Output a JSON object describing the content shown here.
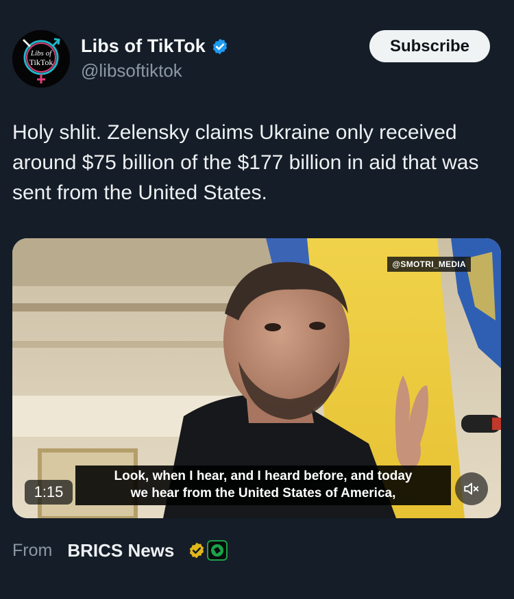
{
  "author": {
    "display_name": "Libs of TikTok",
    "handle": "@libsoftiktok",
    "avatar_text_line1": "Libs of",
    "avatar_text_line2": "TikTok",
    "verified_icon": "verified-badge-icon"
  },
  "actions": {
    "subscribe_label": "Subscribe"
  },
  "tweet": {
    "text": "Holy shlit. Zelensky claims Ukraine only received around $75 billion of the $177 billion in aid that was sent from the United States."
  },
  "video": {
    "watermark": "@SMOTRI_MEDIA",
    "subtitle_line1": "Look, when I hear, and I heard before, and today",
    "subtitle_line2": "we hear from the United States of America,",
    "duration": "1:15",
    "mute_icon": "speaker-muted-icon"
  },
  "source": {
    "from_label": "From",
    "name": "BRICS News"
  },
  "colors": {
    "background": "#151d28",
    "verified_blue": "#1d9bf0",
    "subscribe_bg": "#eff3f4",
    "muted_text": "#8b98a5",
    "badge_gold": "#e2b719",
    "badge_green": "#1aa34a"
  }
}
